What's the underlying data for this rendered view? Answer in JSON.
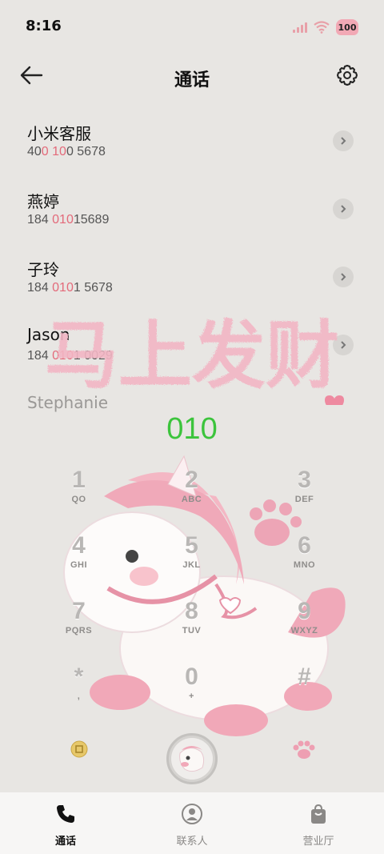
{
  "status": {
    "time": "8:16",
    "battery": "100"
  },
  "header": {
    "title": "通话"
  },
  "contacts": [
    {
      "name": "小米客服",
      "num_parts": [
        "40",
        "0 10",
        "0 5678"
      ]
    },
    {
      "name": "燕婷",
      "num_parts": [
        "184 ",
        "010",
        "15689"
      ]
    },
    {
      "name": "子玲",
      "num_parts": [
        "184 ",
        "010",
        "1 5678"
      ]
    },
    {
      "name": "Jason",
      "num_parts": [
        "184 ",
        "010",
        "1 0029"
      ]
    },
    {
      "name": "Stephanie",
      "num_parts": [
        "",
        "",
        ""
      ]
    }
  ],
  "banner": {
    "text": "马上发财"
  },
  "dialed": "010",
  "keypad": [
    {
      "digit": "1",
      "letters": "QO"
    },
    {
      "digit": "2",
      "letters": "ABC"
    },
    {
      "digit": "3",
      "letters": "DEF"
    },
    {
      "digit": "4",
      "letters": "GHI"
    },
    {
      "digit": "5",
      "letters": "JKL"
    },
    {
      "digit": "6",
      "letters": "MNO"
    },
    {
      "digit": "7",
      "letters": "PQRS"
    },
    {
      "digit": "8",
      "letters": "TUV"
    },
    {
      "digit": "9",
      "letters": "WXYZ"
    },
    {
      "digit": "*",
      "letters": ","
    },
    {
      "digit": "0",
      "letters": "+"
    },
    {
      "digit": "#",
      "letters": ""
    }
  ],
  "nav": [
    {
      "label": "通话",
      "icon": "phone-icon"
    },
    {
      "label": "联系人",
      "icon": "person-icon"
    },
    {
      "label": "营业厅",
      "icon": "bag-icon"
    }
  ],
  "colors": {
    "highlight": "#e36a7a",
    "dialed": "#3cc43c",
    "pink": "#f2a9b5"
  }
}
